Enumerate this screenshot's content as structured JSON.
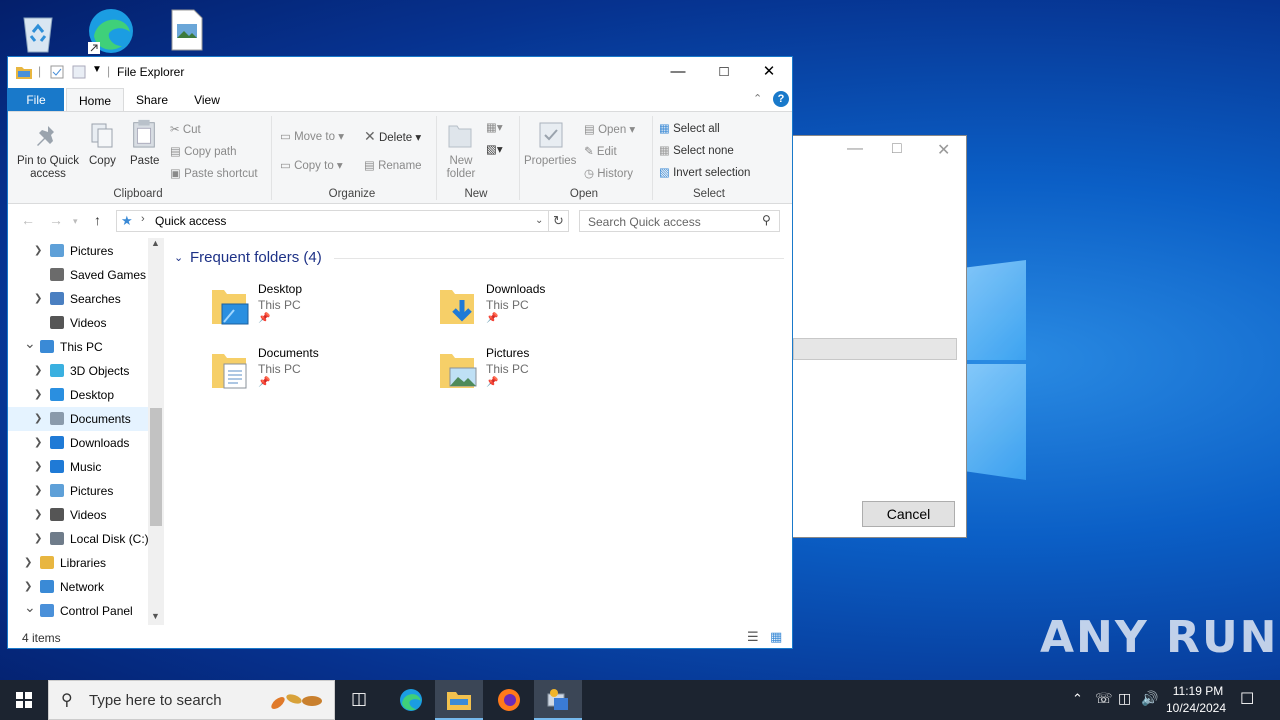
{
  "explorer": {
    "title": "File Explorer",
    "tabs": {
      "file": "File",
      "home": "Home",
      "share": "Share",
      "view": "View"
    },
    "ribbon": {
      "clipboard": {
        "pin": "Pin to Quick access",
        "pin_l1": "Pin to Quick",
        "pin_l2": "access",
        "copy": "Copy",
        "paste": "Paste",
        "cut": "Cut",
        "copy_path": "Copy path",
        "paste_shortcut": "Paste shortcut",
        "label": "Clipboard"
      },
      "organize": {
        "move_to": "Move to",
        "copy_to": "Copy to",
        "delete": "Delete",
        "rename": "Rename",
        "label": "Organize"
      },
      "new": {
        "new_folder_l1": "New",
        "new_folder_l2": "folder",
        "label": "New"
      },
      "open": {
        "properties": "Properties",
        "open": "Open",
        "edit": "Edit",
        "history": "History",
        "label": "Open"
      },
      "select": {
        "select_all": "Select all",
        "select_none": "Select none",
        "invert": "Invert selection",
        "label": "Select"
      }
    },
    "address": {
      "path": "Quick access",
      "search_placeholder": "Search Quick access"
    },
    "nav_items": [
      {
        "label": "Pictures",
        "icon": "pictures-icon"
      },
      {
        "label": "Saved Games",
        "icon": "saved-games-icon"
      },
      {
        "label": "Searches",
        "icon": "searches-icon"
      },
      {
        "label": "Videos",
        "icon": "videos-icon"
      },
      {
        "label": "This PC",
        "icon": "this-pc-icon"
      },
      {
        "label": "3D Objects",
        "icon": "3d-objects-icon"
      },
      {
        "label": "Desktop",
        "icon": "desktop-icon"
      },
      {
        "label": "Documents",
        "icon": "documents-icon"
      },
      {
        "label": "Downloads",
        "icon": "downloads-icon"
      },
      {
        "label": "Music",
        "icon": "music-icon"
      },
      {
        "label": "Pictures",
        "icon": "pictures-icon"
      },
      {
        "label": "Videos",
        "icon": "videos-icon"
      },
      {
        "label": "Local Disk (C:)",
        "icon": "local-disk-icon"
      },
      {
        "label": "Libraries",
        "icon": "libraries-icon"
      },
      {
        "label": "Network",
        "icon": "network-icon"
      },
      {
        "label": "Control Panel",
        "icon": "control-panel-icon"
      }
    ],
    "section_title": "Frequent folders (4)",
    "folders": [
      {
        "name": "Desktop",
        "location": "This PC"
      },
      {
        "name": "Downloads",
        "location": "This PC"
      },
      {
        "name": "Documents",
        "location": "This PC"
      },
      {
        "name": "Pictures",
        "location": "This PC"
      }
    ],
    "status": "4 items"
  },
  "dialog": {
    "cancel": "Cancel"
  },
  "taskbar": {
    "search_placeholder": "Type here to search",
    "time": "11:19 PM",
    "date": "10/24/2024"
  },
  "watermark": "ANY RUN",
  "colors": {
    "accent": "#1979ca",
    "taskbar": "#1c2430",
    "section_title": "#1e3287"
  }
}
